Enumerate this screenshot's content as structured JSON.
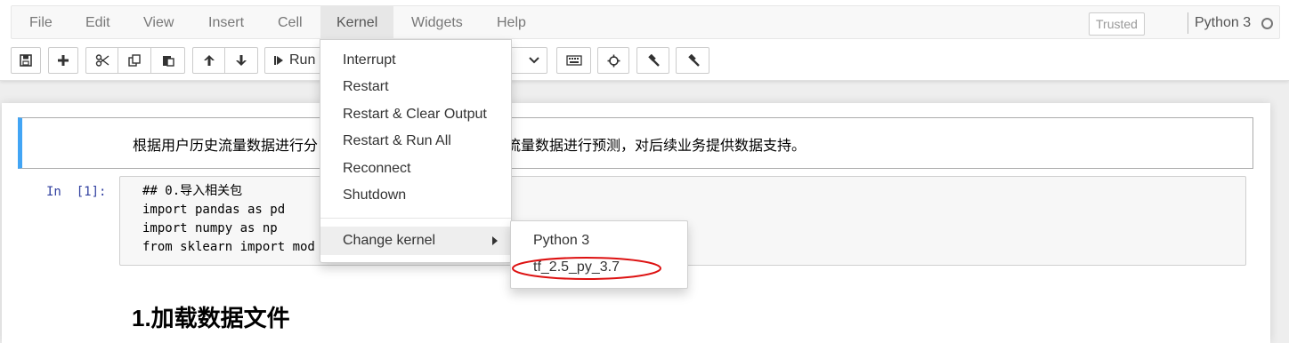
{
  "menubar": {
    "items": [
      "File",
      "Edit",
      "View",
      "Insert",
      "Cell",
      "Kernel",
      "Widgets",
      "Help"
    ],
    "open_item": "Kernel",
    "trusted_label": "Trusted",
    "kernel_name": "Python 3"
  },
  "toolbar": {
    "run_label": "Run",
    "buttons": [
      "save-icon",
      "plus-icon",
      "cut-icon",
      "copy-icon",
      "paste-icon",
      "arrow-up-icon",
      "arrow-down-icon",
      "step-forward-icon",
      "keyboard-icon",
      "crosshairs-icon",
      "gavel-icon",
      "gavel-icon"
    ]
  },
  "kernel_menu": {
    "items": [
      "Interrupt",
      "Restart",
      "Restart & Clear Output",
      "Restart & Run All",
      "Reconnect",
      "Shutdown"
    ],
    "change_kernel": "Change kernel"
  },
  "kernel_submenu": {
    "items": [
      "Python 3",
      "tf_2.5_py_3.7"
    ],
    "highlight_color": "#dd1111"
  },
  "notebook": {
    "markdown_text": "根据用户历史流量数据进行分析，建立模型，对用户未来的流量数据进行预测，对后续业务提供数据支持。",
    "markdown_text_visible_left": "根据用户历史流量数据进行分",
    "markdown_text_visible_right": "流量数据进行预测，对后续业务提供数据支持。",
    "prompt": "In  [1]:",
    "code_lines": [
      "## 0.导入相关包",
      "import pandas as pd",
      "import numpy as np",
      "from sklearn import mod"
    ],
    "heading": "1.加载数据文件"
  },
  "colors": {
    "accent_blue": "#42a5f5",
    "prompt_blue": "#303f9f",
    "menu_open_bg": "#e7e7e7"
  }
}
